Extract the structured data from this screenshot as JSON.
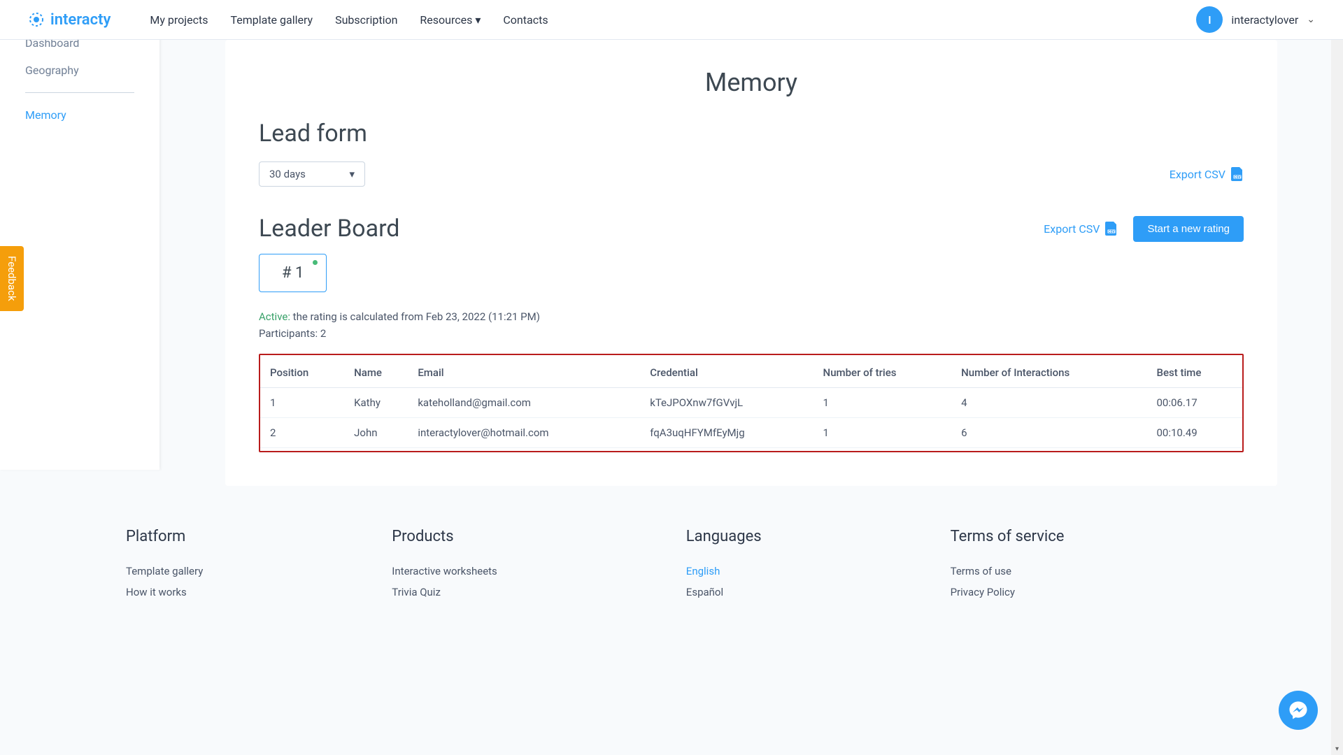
{
  "header": {
    "logo_text": "interacty",
    "nav": [
      "My projects",
      "Template gallery",
      "Subscription",
      "Resources",
      "Contacts"
    ],
    "user_initial": "I",
    "user_name": "interactylover"
  },
  "sidebar": {
    "items": [
      "Dashboard",
      "Geography"
    ],
    "active": "Memory"
  },
  "page": {
    "title": "Memory",
    "leadform_title": "Lead form",
    "period_selected": "30 days",
    "export_csv_label": "Export CSV",
    "leaderboard_title": "Leader Board",
    "start_rating_label": "Start a new rating",
    "rating_badge": "# 1",
    "status_active": "Active:",
    "status_text": " the rating is calculated from Feb 23, 2022 (11:21 PM)",
    "participants_label": "Participants: ",
    "participants_count": "2",
    "table": {
      "headers": [
        "Position",
        "Name",
        "Email",
        "Credential",
        "Number of tries",
        "Number of Interactions",
        "Best time"
      ],
      "rows": [
        {
          "position": "1",
          "name": "Kathy",
          "email": "kateholland@gmail.com",
          "credential": "kTeJPOXnw7fGVvjL",
          "tries": "1",
          "interactions": "4",
          "best_time": "00:06.17"
        },
        {
          "position": "2",
          "name": "John",
          "email": "interactylover@hotmail.com",
          "credential": "fqA3uqHFYMfEyMjg",
          "tries": "1",
          "interactions": "6",
          "best_time": "00:10.49"
        }
      ]
    }
  },
  "footer": {
    "platform": {
      "title": "Platform",
      "links": [
        "Template gallery",
        "How it works"
      ]
    },
    "products": {
      "title": "Products",
      "links": [
        "Interactive worksheets",
        "Trivia Quiz"
      ]
    },
    "languages": {
      "title": "Languages",
      "links": [
        "English",
        "Español"
      ],
      "active": "English"
    },
    "terms": {
      "title": "Terms of service",
      "links": [
        "Terms of use",
        "Privacy Policy"
      ]
    }
  },
  "feedback_label": "Feedback"
}
